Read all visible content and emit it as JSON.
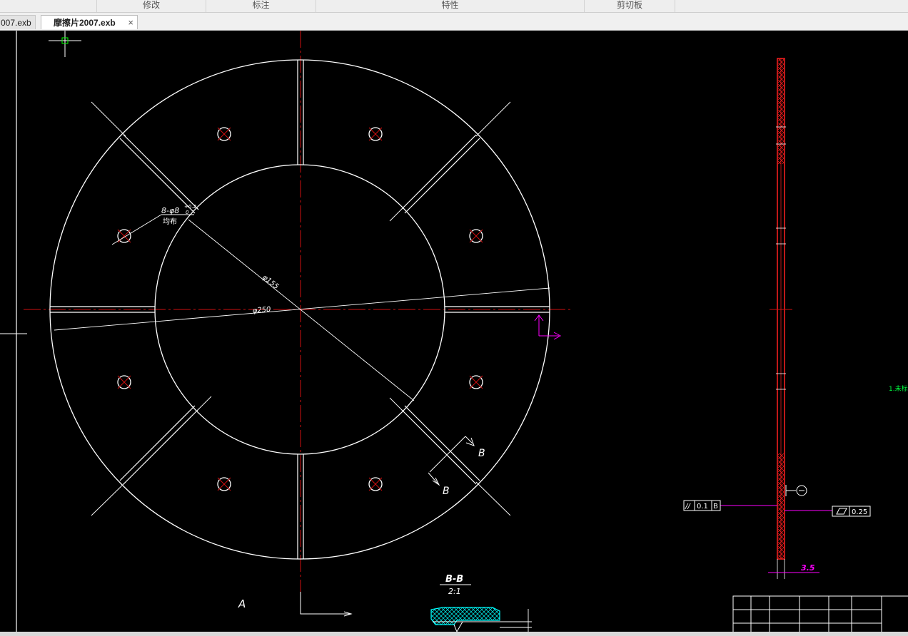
{
  "app": {
    "ribbon_groups": [
      "修改",
      "标注",
      "特性",
      "剪切板"
    ],
    "tabs": [
      {
        "label": "007.exb",
        "active": false
      },
      {
        "label": "摩擦片2007.exb",
        "active": true
      }
    ],
    "close_glyph": "×"
  },
  "drawing": {
    "hole_note_line1": "8-φ8",
    "hole_note_sup": "+0.2",
    "hole_note_sub": "0",
    "hole_note_line2": "均布",
    "dim_inner": "φ155",
    "dim_outer": "φ250",
    "section_label_1": "B",
    "section_label_2": "B",
    "view_label": "A",
    "section_title": "B-B",
    "section_scale": "2:1",
    "tol_parallel_symbol": "//",
    "tol_parallel_value": "0.1",
    "tol_parallel_datum": "B",
    "tol_flatness_value": "0.25",
    "thickness_dim": "3.5",
    "note_text": "1.未标"
  },
  "colors": {
    "background": "#000000",
    "line_white": "#ffffff",
    "centerline_red": "#d01010",
    "section_red": "#ff2020",
    "magenta": "#ff00ff",
    "note_green": "#00ff40",
    "hatch_cyan": "#00ffff"
  }
}
